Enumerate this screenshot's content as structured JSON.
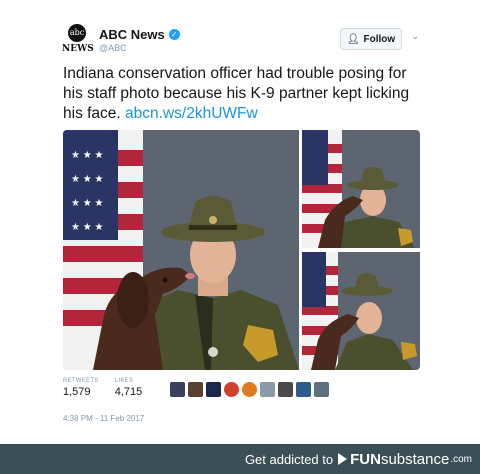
{
  "tweet": {
    "display_name": "ABC News",
    "handle": "@ABC",
    "avatar_logo_text": "abc",
    "avatar_news_text": "NEWS",
    "follow_label": "Follow",
    "text_body": "Indiana conservation officer had trouble posing for his staff photo because his K-9 partner kept licking his face.",
    "link": "abcn.ws/2khUWFw",
    "stats": {
      "retweets_label": "RETWEETS",
      "retweets_value": "1,579",
      "likes_label": "LIKES",
      "likes_value": "4,715"
    },
    "timestamp": "4:38 PM - 11 Feb 2017",
    "liker_colors": [
      "#3a3f5c",
      "#5a4030",
      "#1b2a4a",
      "#d0402a",
      "#e07a20",
      "#8a9aa8",
      "#4a4a4a",
      "#2e5c8a",
      "#607080"
    ]
  },
  "colors": {
    "accent": "#1da1f2",
    "link": "#1b95e0",
    "uniform": "#4a4f2e",
    "hat": "#5b5a36",
    "dog": "#4a2a1c",
    "flag_red": "#b3253a",
    "flag_blue": "#2a3566",
    "backdrop": "#5d6670",
    "footer_bg": "#3b4f56"
  },
  "icons": {
    "verified": "check-badge",
    "follow": "add-user",
    "more": "chevron-down",
    "brand": "play-arrow"
  },
  "footer": {
    "tagline": "Get addicted to",
    "brand_funs": "FUN",
    "brand_sub": "substance",
    "brand_com": ".com"
  }
}
